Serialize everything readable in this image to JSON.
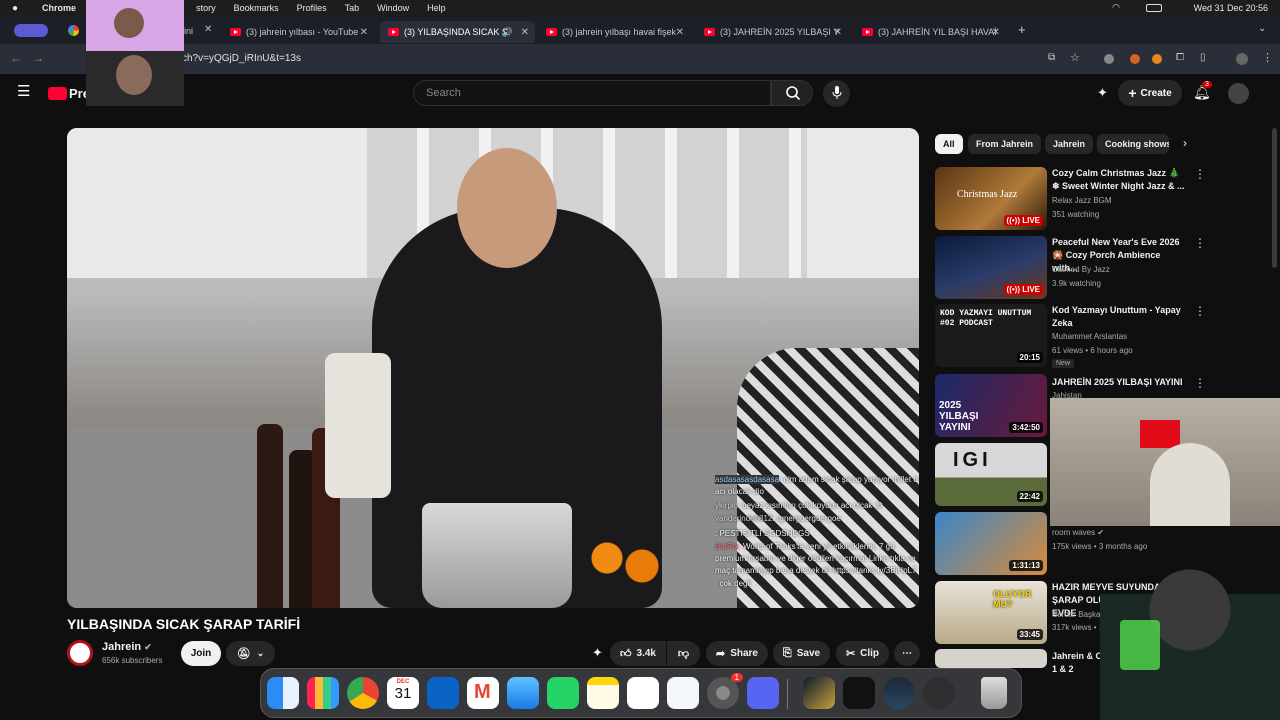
{
  "menubar": {
    "apple": "",
    "app": "Chrome",
    "items": [
      "History",
      "Bookmarks",
      "Profiles",
      "Tab",
      "Window",
      "Help"
    ],
    "items_visible": [
      "story",
      "Bookmarks",
      "Profiles",
      "Tab",
      "Window",
      "Help"
    ],
    "clock": "Wed 31 Dec  20:56"
  },
  "tabs": [
    {
      "label": "(3) jahrein yılbası - YouTube",
      "active": false
    },
    {
      "label": "(3) YILBAŞINDA SICAK Ş",
      "active": true
    },
    {
      "label": "(3) jahrein yılbaşı havai fişek",
      "active": false
    },
    {
      "label": "(3) JAHREİN 2025 YILBAŞI Y",
      "active": false
    },
    {
      "label": "(3) JAHREİN YIL BAŞI HAVAİ",
      "active": false
    }
  ],
  "tab_first_partial": "ini",
  "address": {
    "url": "ch?v=yQGjD_iRInU&t=13s"
  },
  "youtube": {
    "logo_text": "Pre",
    "search_placeholder": "Search",
    "create_label": "Create",
    "notification_count": "3"
  },
  "video": {
    "title": "YILBAŞINDA SICAK ŞARAP TARİFİ",
    "channel": "Jahrein",
    "subscribers": "656k subscribers",
    "join_label": "Join",
    "likes": "3.4k",
    "share_label": "Share",
    "save_label": "Save",
    "clip_label": "Clip"
  },
  "chat_lines": [
    {
      "user": "asdasasasdasasa",
      "text": ": olm adam sıcak şarap yapıyor millet d"
    },
    {
      "user": "",
      "text": "acı olacak dio"
    },
    {
      "user": "ykirpiç",
      "text": ": beyaz kısımları çok koydun acı olcak :D"
    },
    {
      "user": "vanderinde0812",
      "text": ": rgnergoerguergoe"
    },
    {
      "user": "",
      "text": ": PESTISITLI SGDSHDGS"
    },
    {
      "user": "BotRix",
      "text": ": World of Tanks'ta yeni yıl etkinliklerini, 7 gü"
    },
    {
      "user": "",
      "text": "premium fırsatını ve diğer ödülleri kaçırma! Linke tıkla ve"
    },
    {
      "user": "",
      "text": "maç tamamlayıp bana destek ol! https://tanks.ly/3BjHpL7"
    },
    {
      "user": "",
      "text": ": çok degil"
    }
  ],
  "chips": [
    "All",
    "From Jahrein",
    "Jahrein",
    "Cooking shows"
  ],
  "recommendations": [
    {
      "title": "Cozy Calm Christmas Jazz 🎄❄ Sweet Winter Night Jazz & ...",
      "channel": "Relax Jazz BGM",
      "meta": "351 watching",
      "badge": "LIVE",
      "thumb_text": "Christmas Jazz"
    },
    {
      "title": "Peaceful New Year's Eve 2026 🎇 Cozy Porch Ambience with...",
      "channel": "Calmed By Jazz",
      "meta": "3.9k watching",
      "badge": "LIVE",
      "thumb_text": ""
    },
    {
      "title": "Kod Yazmayı Unuttum - Yapay Zeka",
      "channel": "Muhammet Arslantas",
      "meta": "61 views • 6 hours ago",
      "extra": "New",
      "badge": "20:15",
      "thumb_text": "KOD YAZMAYI UNUTTUM  #02  PODCAST"
    },
    {
      "title": "JAHREİN 2025 YILBAŞI YAYINI",
      "channel": "Jahistan",
      "meta": "",
      "badge": "3:42:50",
      "thumb_text": "2025 YILBAŞI YAYINI"
    },
    {
      "title": "",
      "channel": "",
      "meta": "",
      "badge": "22:42",
      "thumb_text": "IGI"
    },
    {
      "title": "",
      "channel": "room waves",
      "meta": "175k views • 3 months ago",
      "badge": "1:31:13",
      "thumb_text": ""
    },
    {
      "title": "HAZIR MEYVE SUYUNDA ŞARAP OLUR MU? - EVDE",
      "channel": "Serdar Başkan",
      "meta": "317k views • 1 year ago",
      "badge": "33:45",
      "thumb_text": "OLUYOR MU?"
    },
    {
      "title": "Jahrein & Carli Derlemesi 1 & 2",
      "channel": "",
      "meta": "",
      "badge": "",
      "thumb_text": ""
    }
  ],
  "dock": {
    "calendar_month": "DEC",
    "calendar_day": "31",
    "settings_badge": "1"
  },
  "colors": {
    "yt_red": "#ff0033",
    "bg": "#0f0f0f",
    "live_red": "#cc0000"
  }
}
